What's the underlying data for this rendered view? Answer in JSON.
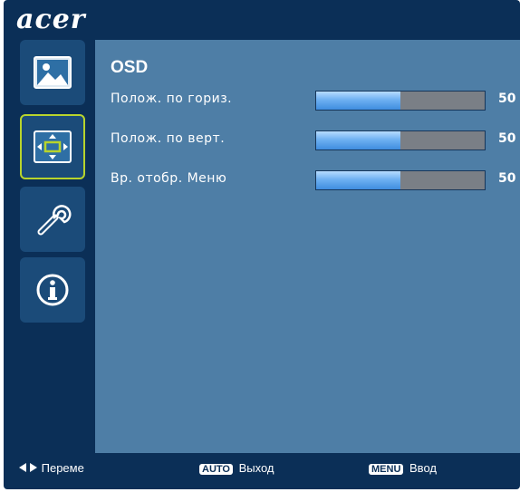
{
  "brand": "acer",
  "sidebar": {
    "items": [
      {
        "icon": "picture-icon",
        "selected": false
      },
      {
        "icon": "osd-position-icon",
        "selected": true
      },
      {
        "icon": "wrench-settings-icon",
        "selected": false
      },
      {
        "icon": "info-icon",
        "selected": false
      }
    ]
  },
  "main": {
    "title": "OSD",
    "rows": [
      {
        "label": "Полож. по гориз.",
        "value": "50",
        "level": 0.5
      },
      {
        "label": "Полож. по верт.",
        "value": "50",
        "level": 0.5
      },
      {
        "label": "Вр. отобр. Меню",
        "value": "50",
        "level": 0.5
      }
    ]
  },
  "footer": {
    "navigate_label": "Переме",
    "auto_key": "AUTO",
    "auto_label": "Выход",
    "menu_key": "MENU",
    "menu_label": "Ввод"
  },
  "colors": {
    "frame": "#0b2f57",
    "panel": "#4e7ea6",
    "sidebar_tile": "#1b4b79",
    "selected_border": "#b8d42c",
    "slider_fill": "#6fb1f2",
    "slider_empty": "#7a7f86"
  }
}
